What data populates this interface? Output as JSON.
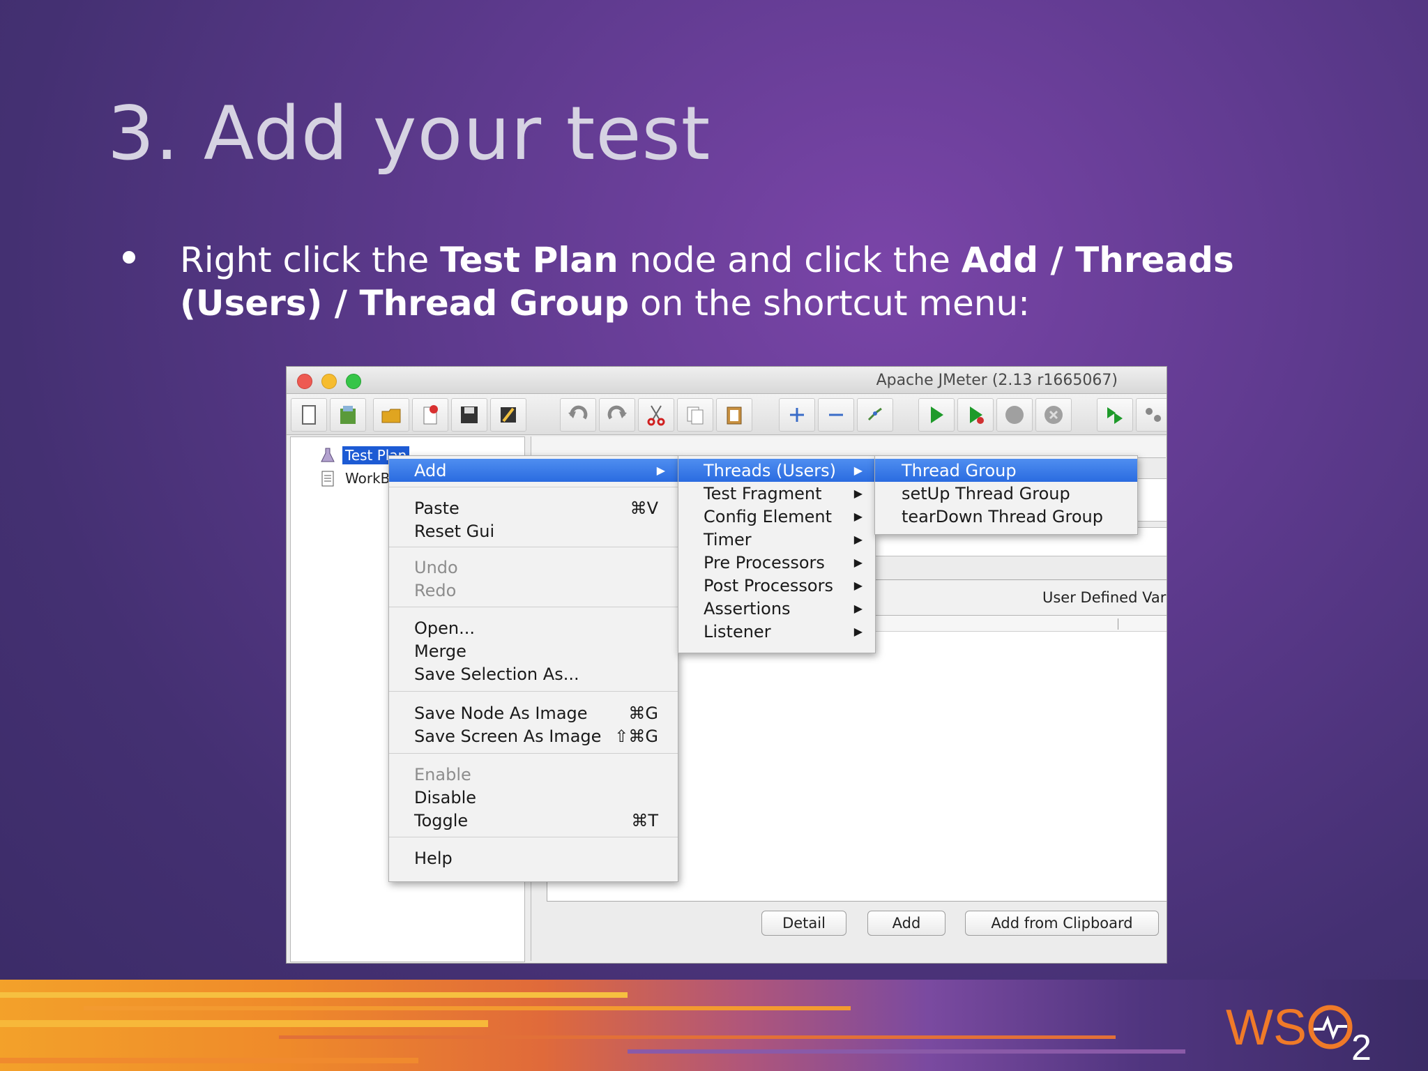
{
  "slide": {
    "title": "3. Add your test",
    "bullet": {
      "pre1": "Right click the ",
      "bold1": "Test Plan",
      "mid1": " node and click the ",
      "bold2": "Add / Threads (Users) / Thread Group",
      "post": " on the shortcut menu:"
    },
    "logo": "WSO2"
  },
  "window": {
    "title": "Apache JMeter (2.13 r1665067)",
    "toolbar_icons": [
      "new-icon",
      "templates-icon",
      "open-icon",
      "close-icon",
      "save-icon",
      "edit-icon",
      "undo-icon",
      "redo-icon",
      "cut-icon",
      "copy-icon",
      "paste-icon",
      "expand-icon",
      "collapse-icon",
      "toggle-icon",
      "start-icon",
      "start-no-pause-icon",
      "stop-icon",
      "shutdown-icon",
      "remote-start-icon",
      "remote-icon"
    ]
  },
  "tree": {
    "items": [
      {
        "label": "Test Plan",
        "selected": true
      },
      {
        "label": "WorkBe",
        "selected": false
      }
    ]
  },
  "right_pane": {
    "udv_label": "User Defined Vari",
    "buttons": {
      "detail": "Detail",
      "add": "Add",
      "add_clipboard": "Add from Clipboard"
    }
  },
  "context_menu": {
    "items": [
      {
        "label": "Add",
        "shortcut": "",
        "submenu": true,
        "highlight": true,
        "disabled": false
      },
      {
        "label": "Paste",
        "shortcut": "⌘V",
        "disabled": false
      },
      {
        "label": "Reset Gui",
        "shortcut": "",
        "disabled": false
      },
      {
        "label": "Undo",
        "shortcut": "",
        "disabled": true
      },
      {
        "label": "Redo",
        "shortcut": "",
        "disabled": true
      },
      {
        "label": "Open...",
        "shortcut": "",
        "disabled": false
      },
      {
        "label": "Merge",
        "shortcut": "",
        "disabled": false
      },
      {
        "label": "Save Selection As...",
        "shortcut": "",
        "disabled": false
      },
      {
        "label": "Save Node As Image",
        "shortcut": "⌘G",
        "disabled": false
      },
      {
        "label": "Save Screen As Image",
        "shortcut": "⇧⌘G",
        "disabled": false
      },
      {
        "label": "Enable",
        "shortcut": "",
        "disabled": true
      },
      {
        "label": "Disable",
        "shortcut": "",
        "disabled": false
      },
      {
        "label": "Toggle",
        "shortcut": "⌘T",
        "disabled": false
      },
      {
        "label": "Help",
        "shortcut": "",
        "disabled": false
      }
    ]
  },
  "add_submenu": {
    "items": [
      {
        "label": "Threads (Users)",
        "highlight": true
      },
      {
        "label": "Test Fragment",
        "highlight": false
      },
      {
        "label": "Config Element",
        "highlight": false
      },
      {
        "label": "Timer",
        "highlight": false
      },
      {
        "label": "Pre Processors",
        "highlight": false
      },
      {
        "label": "Post Processors",
        "highlight": false
      },
      {
        "label": "Assertions",
        "highlight": false
      },
      {
        "label": "Listener",
        "highlight": false
      }
    ]
  },
  "threads_submenu": {
    "items": [
      {
        "label": "Thread Group",
        "highlight": true
      },
      {
        "label": "setUp Thread Group",
        "highlight": false
      },
      {
        "label": "tearDown Thread Group",
        "highlight": false
      }
    ]
  },
  "colors": {
    "menu_highlight": "#2a6be0",
    "tree_selected": "#1d5bd4",
    "logo_orange": "#f07a28"
  }
}
